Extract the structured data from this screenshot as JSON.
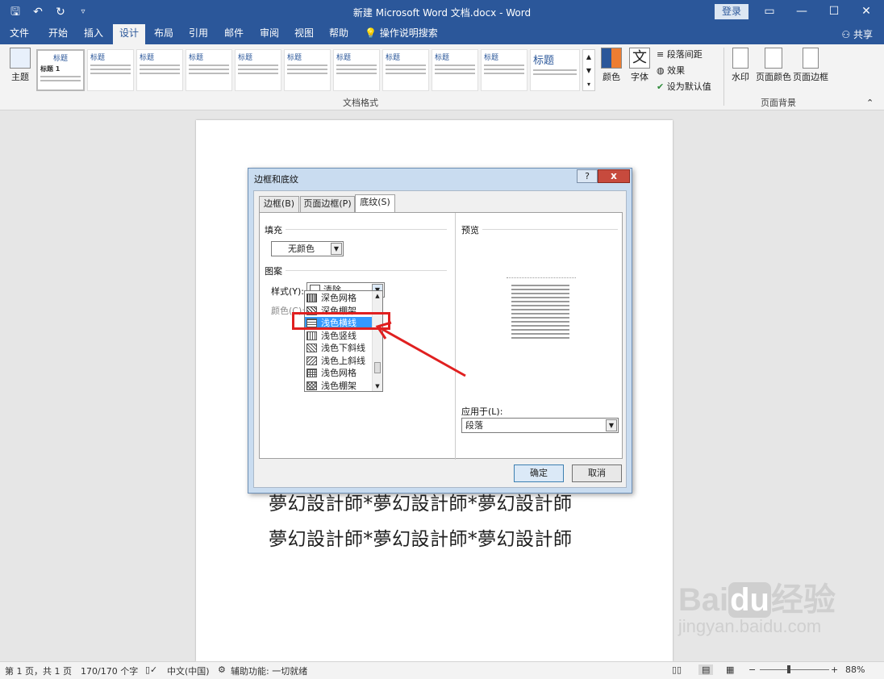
{
  "window": {
    "title": "新建 Microsoft Word 文档.docx  -  Word",
    "login": "登录",
    "qat_icons": [
      "save-icon",
      "undo-icon",
      "redo-icon",
      "customize-icon"
    ]
  },
  "tabs": [
    {
      "label": "文件"
    },
    {
      "label": "开始"
    },
    {
      "label": "插入"
    },
    {
      "label": "设计",
      "active": true
    },
    {
      "label": "布局"
    },
    {
      "label": "引用"
    },
    {
      "label": "邮件"
    },
    {
      "label": "审阅"
    },
    {
      "label": "视图"
    },
    {
      "label": "帮助"
    }
  ],
  "tell_me": "操作说明搜索",
  "share": "共享",
  "ribbon": {
    "theme": "主题",
    "first_style_title": "标题",
    "first_style_heading": "标题 1",
    "style_titles": [
      "标题",
      "标题",
      "标题",
      "标题",
      "标题",
      "标题",
      "标题",
      "标题",
      "标题",
      "标题"
    ],
    "colors": "颜色",
    "fonts": "字体",
    "font_glyph": "文",
    "paragraph_spacing": "段落间距",
    "effects": "效果",
    "set_default": "设为默认值",
    "doc_format_group": "文档格式",
    "watermark": "水印",
    "page_color": "页面颜色",
    "page_borders": "页面边框",
    "page_background_group": "页面背景"
  },
  "document": {
    "line1": "夢幻設計師*夢幻設計師*夢幻設計師",
    "line2": "夢幻設計師*夢幻設計師*夢幻設計師"
  },
  "watermark_site": {
    "brand_a": "Bai",
    "brand_b": "du",
    "brand_c": "经验",
    "url": "jingyan.baidu.com"
  },
  "dialog": {
    "title": "边框和底纹",
    "help": "?",
    "close": "x",
    "tabs": [
      {
        "label": "边框(B)"
      },
      {
        "label": "页面边框(P)"
      },
      {
        "label": "底纹(S)",
        "active": true
      }
    ],
    "fill_label": "填充",
    "fill_value": "无颜色",
    "pattern_label": "图案",
    "style_label": "样式(Y):",
    "style_value": "清除",
    "color_label": "颜色(C):",
    "pattern_options": [
      {
        "label": "深色网格"
      },
      {
        "label": "深色棚架"
      },
      {
        "label": "浅色横线",
        "selected": true
      },
      {
        "label": "浅色竖线"
      },
      {
        "label": "浅色下斜线"
      },
      {
        "label": "浅色上斜线"
      },
      {
        "label": "浅色网格"
      },
      {
        "label": "浅色棚架"
      }
    ],
    "preview_label": "预览",
    "apply_to_label": "应用于(L):",
    "apply_to_value": "段落",
    "ok": "确定",
    "cancel": "取消"
  },
  "status": {
    "page": "第 1 页，共 1 页",
    "words": "170/170 个字",
    "language": "中文(中国)",
    "accessibility": "辅助功能: 一切就绪",
    "zoom": "88%",
    "zoom_minus": "−",
    "zoom_plus": "+"
  },
  "colors": {
    "word_blue": "#2b579a",
    "highlight_red": "#e02020",
    "selection_blue": "#3399ff"
  }
}
